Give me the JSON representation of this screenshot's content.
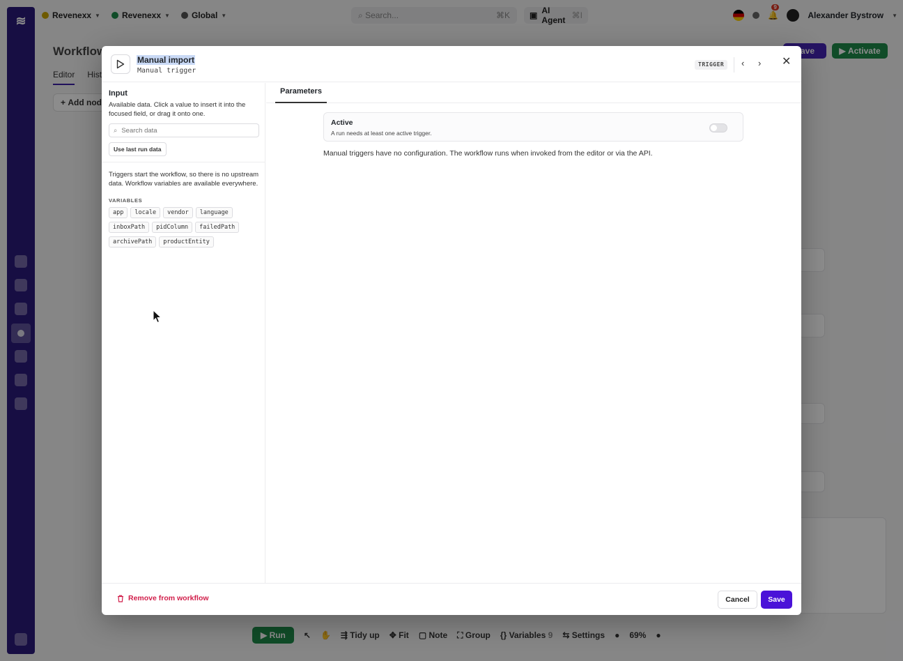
{
  "topbar": {
    "workspace1": "Revenexx",
    "workspace2": "Revenexx",
    "scope": "Global",
    "search_placeholder": "Search...",
    "search_shortcut": "⌘K",
    "ai_agent_label": "AI Agent",
    "ai_agent_shortcut": "⌘I",
    "notifications_count": "9",
    "user_name": "Alexander Bystrow"
  },
  "background": {
    "page_title": "Workflows",
    "tab_editor": "Editor",
    "tab_history": "History",
    "add_node_label": "Add node",
    "save_label": "Save",
    "activate_label": "Activate",
    "bottombar": {
      "run": "Run",
      "tidy": "Tidy up",
      "fit": "Fit",
      "note": "Note",
      "group": "Group",
      "variables": "Variables",
      "variables_count": "9",
      "settings": "Settings",
      "zoom": "69%"
    }
  },
  "modal": {
    "node_title": "Manual import",
    "node_subtitle": "Manual trigger",
    "badge": "TRIGGER",
    "input": {
      "title": "Input",
      "description": "Available data. Click a value to insert it into the focused field, or drag it onto one.",
      "search_placeholder": "Search data",
      "last_run_button": "Use last run data",
      "info": "Triggers start the workflow, so there is no upstream data. Workflow variables are available everywhere.",
      "variables_heading": "VARIABLES",
      "variables": [
        "app",
        "locale",
        "vendor",
        "language",
        "inboxPath",
        "pidColumn",
        "failedPath",
        "archivePath",
        "productEntity"
      ]
    },
    "tabs": {
      "parameters": "Parameters"
    },
    "active": {
      "title": "Active",
      "subtitle": "A run needs at least one active trigger."
    },
    "note": "Manual triggers have no configuration. The workflow runs when invoked from the editor or via the API.",
    "footer": {
      "remove": "Remove from workflow",
      "cancel": "Cancel",
      "save": "Save"
    }
  },
  "colors": {
    "accent": "#4a12d8",
    "danger": "#d11e4a",
    "rail": "#2b1a7a",
    "activate": "#1e8a4a"
  }
}
